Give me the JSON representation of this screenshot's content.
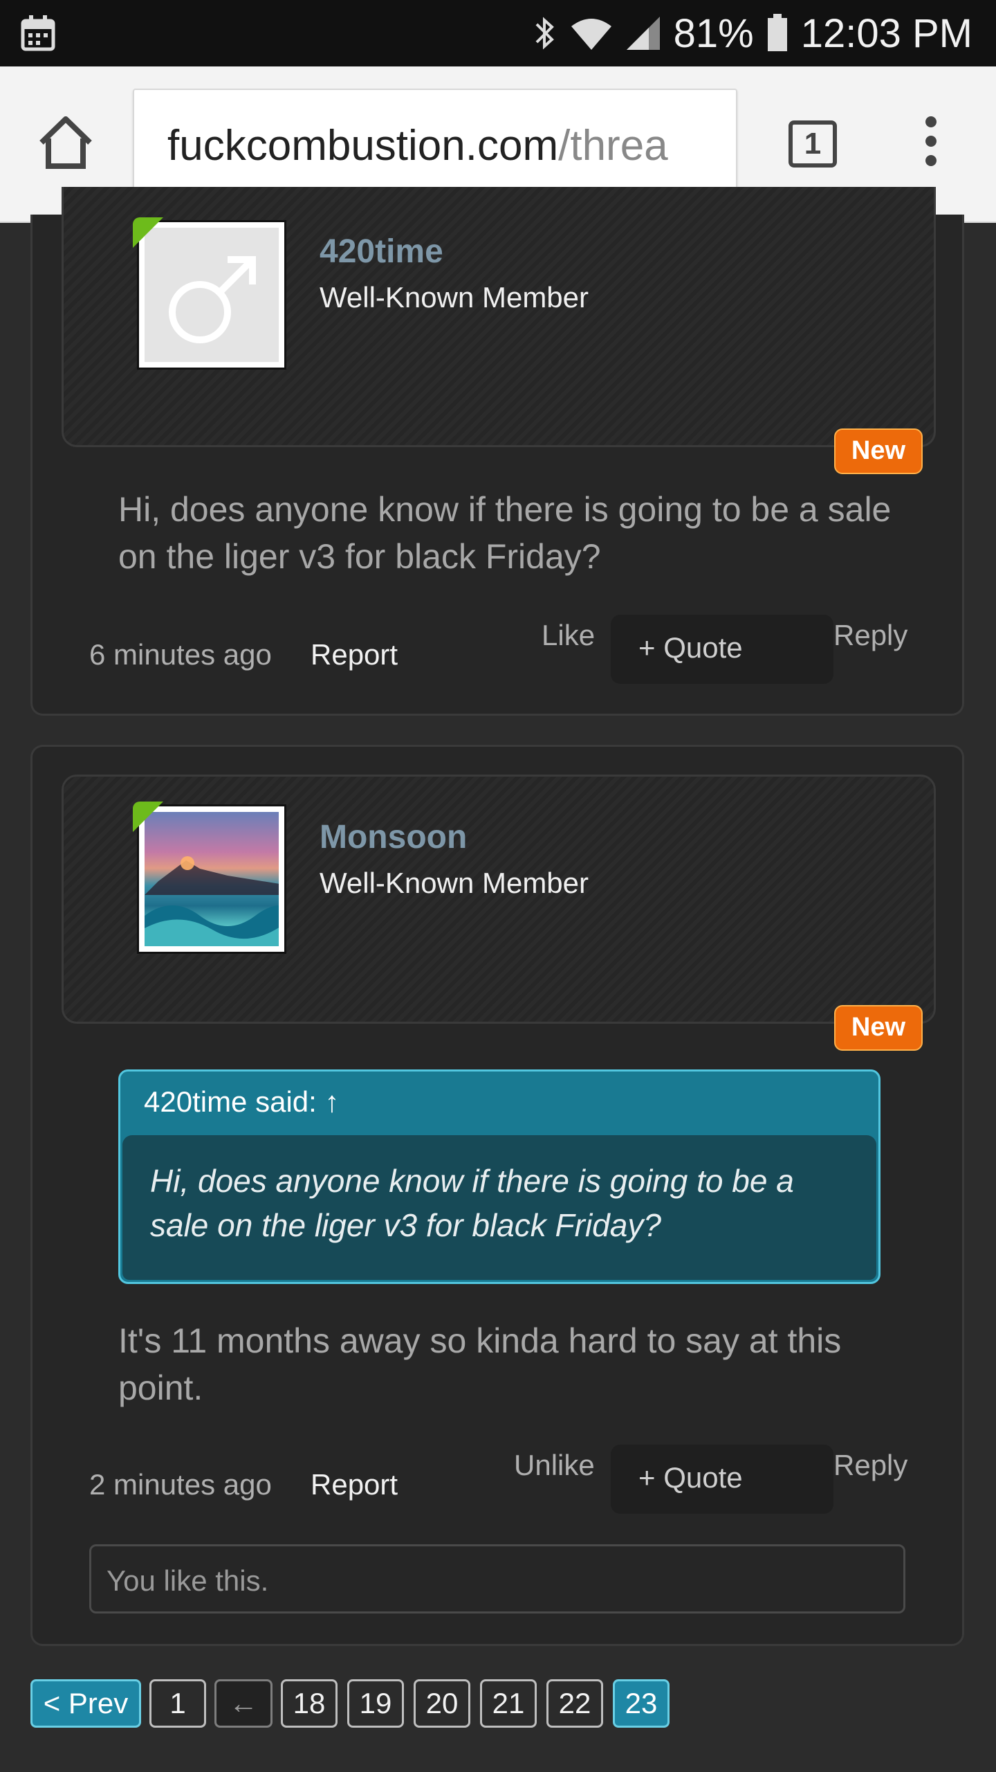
{
  "status_bar": {
    "battery": "81%",
    "time": "12:03 PM"
  },
  "browser": {
    "url_domain": "fuckcombustion.com",
    "url_path": "/threa",
    "tab_count": "1"
  },
  "posts": [
    {
      "username": "420time",
      "user_title": "Well-Known Member",
      "badge": "New",
      "message": "Hi, does anyone know if there is going to be a sale on the liger v3 for black Friday?",
      "time": "6 minutes ago",
      "report": "Report",
      "like": "Like",
      "quote": "+ Quote",
      "reply": "Reply"
    },
    {
      "username": "Monsoon",
      "user_title": "Well-Known Member",
      "badge": "New",
      "quote_header": "420time said: ↑",
      "quote_text": "Hi, does anyone know if there is going to be a sale on the liger v3 for black Friday?",
      "message": "It's 11 months away so kinda hard to say at this point.",
      "time": "2 minutes ago",
      "report": "Report",
      "like": "Unlike",
      "quote": "+ Quote",
      "reply": "Reply",
      "likes_summary": "You like this."
    }
  ],
  "pagination": {
    "prev": "< Prev",
    "pages": [
      "1",
      "←",
      "18",
      "19",
      "20",
      "21",
      "22",
      "23"
    ],
    "current": "23"
  },
  "colors": {
    "accent": "#1e87a5",
    "new_badge": "#ed6a0b",
    "online": "#6dbb1b",
    "username": "#7e97a8"
  },
  "icons": [
    "calendar-icon",
    "bluetooth-icon",
    "wifi-icon",
    "signal-icon",
    "battery-icon",
    "home-icon",
    "tabs-icon",
    "overflow-menu-icon",
    "male-symbol-icon"
  ]
}
